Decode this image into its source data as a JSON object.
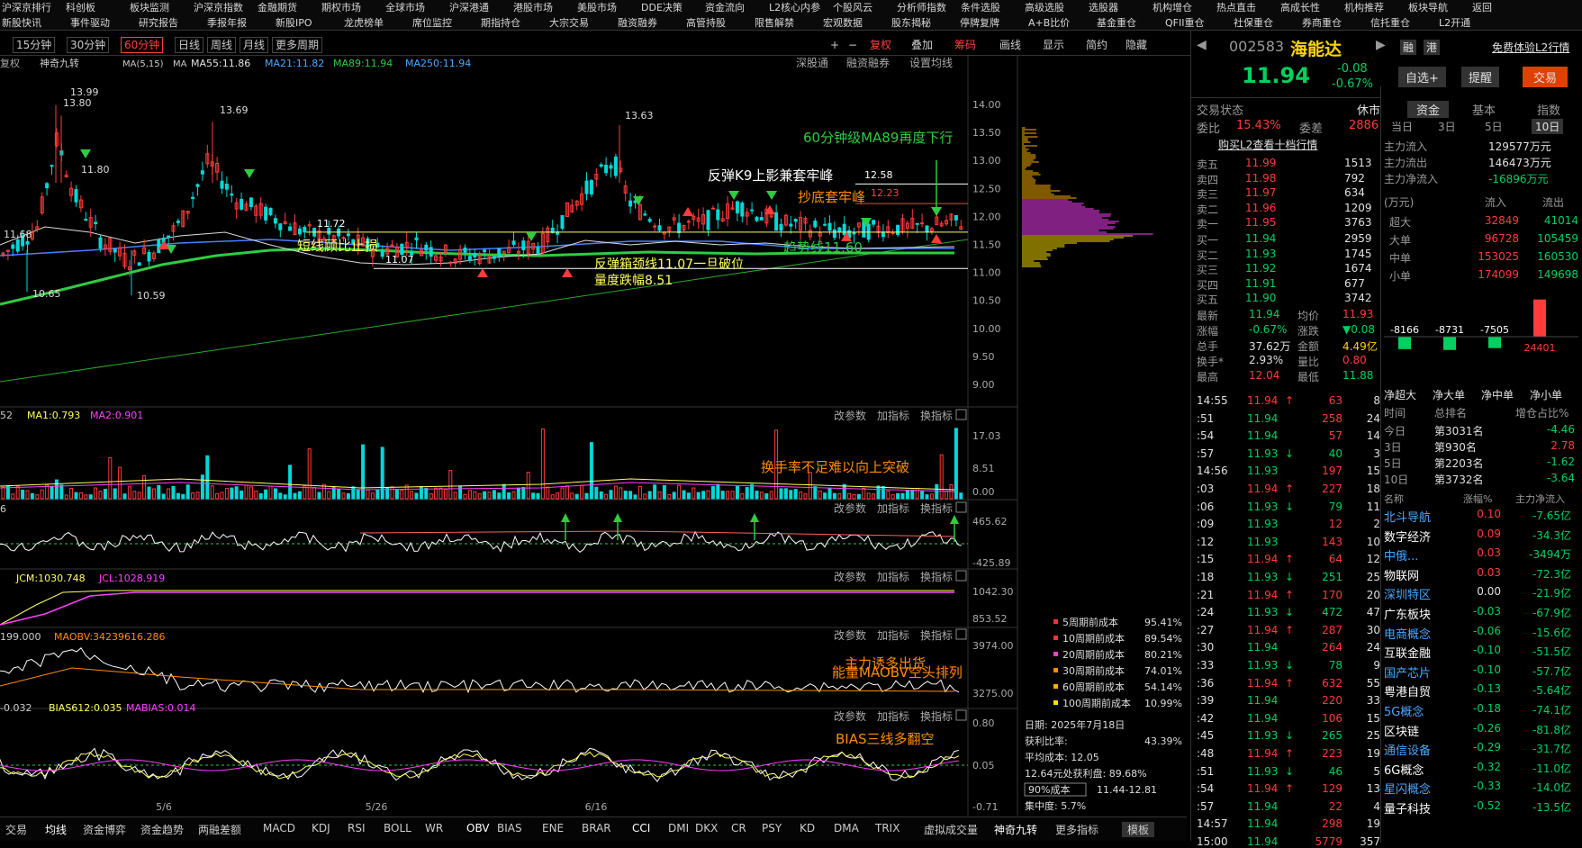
{
  "menu": {
    "row1": [
      "沪深京排行",
      "科创板",
      "板块监测",
      "沪深京指数",
      "金融期货",
      "期权市场",
      "全球市场",
      "沪深港通",
      "港股市场",
      "美股市场",
      "DDE决策",
      "资金流向",
      "L2核心内参",
      "个股风云",
      "分析师指数",
      "条件选股",
      "高级选股",
      "选股器",
      "机构增仓",
      "热点直击",
      "高成长性",
      "机构推荐",
      "板块导航",
      "返回"
    ],
    "row2": [
      "新股快讯",
      "事件驱动",
      "研究报告",
      "季报年报",
      "新股IPO",
      "龙虎榜单",
      "席位监控",
      "期指持仓",
      "大宗交易",
      "融资融券",
      "高管持股",
      "限售解禁",
      "宏观数据",
      "股东揭秘",
      "停牌复牌",
      "A+B比价",
      "基金重仓",
      "QFII重仓",
      "社保重仓",
      "券商重仓",
      "信托重仓",
      "L2开通"
    ]
  },
  "toolbar": {
    "timeframes": [
      "15分钟",
      "30分钟",
      "60分钟",
      "日线",
      "周线",
      "月线",
      "更多周期"
    ],
    "right_tools": [
      "+",
      "−",
      "复权",
      "叠加",
      "筹码",
      "画线",
      "显示",
      "简约",
      "隐藏"
    ],
    "ma_line": {
      "prefix": "复权",
      "indicator": "神奇九转",
      "ma_label": "MA(5,15)",
      "ma": "MA",
      "ma55": "MA55:11.86",
      "ma21": "MA21:11.82",
      "ma89": "MA89:11.94",
      "ma250": "MA250:11.94"
    },
    "chart_links": [
      "深股通",
      "融资融券",
      "设置均线"
    ]
  },
  "annotations": {
    "a1": "60分钟级MA89再度下行",
    "a2": "反弹K9上影兼套牢峰",
    "a3": "抄底套牢峰",
    "a4": "短线顾比止损",
    "a5": "趋势线11.60",
    "a6": "反弹箱颈线11.07一旦破位",
    "a7": "量度跌幅8.51",
    "a8": "换手率不足难以向上突破",
    "a9": "主力诱多出货",
    "a10": "能量MAOBV空头排列",
    "a11": "BIAS三线多翻空",
    "p1": "13.99",
    "p2": "13.80",
    "p3": "13.69",
    "p4": "13.63",
    "p5": "12.58",
    "p6": "12.23",
    "p7": "11.72",
    "p8": "11.07",
    "p9": "10.65",
    "p10": "10.59",
    "p11": "11.68",
    "p12": "11.80"
  },
  "price_axis": [
    "14.00",
    "13.50",
    "13.00",
    "12.50",
    "12.00",
    "11.50",
    "11.00",
    "10.50",
    "10.00",
    "9.50",
    "9.00"
  ],
  "panels": {
    "vol": {
      "label": "52",
      "ma1": "MA1:0.793",
      "ma2": "MA2:0.901",
      "ax": [
        "17.03",
        "8.51",
        "0.00"
      ]
    },
    "p2": {
      "label": "6",
      "ax": [
        "465.62",
        "-425.89"
      ]
    },
    "p3": {
      "jcm": "JCM:1030.748",
      "jcl": "JCL:1028.919",
      "ax": [
        "1042.30",
        "853.52"
      ]
    },
    "p4": {
      "obv": "199.000",
      "maobv": "MAOBV:34239616.286",
      "ax": [
        "3974.00",
        "3275.00"
      ]
    },
    "p5": {
      "bias6": "-0.032",
      "bias612": "BIAS612:0.035",
      "mabias": "MABIAS:0.014",
      "ax": [
        "0.80",
        "0.05",
        "-0.71"
      ]
    },
    "panel_btns": [
      "改参数",
      "加指标",
      "换指标"
    ]
  },
  "dates": [
    "5/6",
    "5/26",
    "6/16"
  ],
  "cost": {
    "legend": [
      {
        "label": "5周期前成本",
        "value": "95.41%",
        "color": "#ff3030"
      },
      {
        "label": "10周期前成本",
        "value": "89.54%",
        "color": "#ff3030"
      },
      {
        "label": "20周期前成本",
        "value": "80.21%",
        "color": "#ff40c0"
      },
      {
        "label": "30周期前成本",
        "value": "74.01%",
        "color": "#ff8c00"
      },
      {
        "label": "60周期前成本",
        "value": "54.14%",
        "color": "#ffb000"
      },
      {
        "label": "100周期前成本",
        "value": "10.99%",
        "color": "#ffe000"
      }
    ],
    "date": "日期: 2025年7月18日",
    "profit_label": "获利比率:",
    "profit": "43.39%",
    "avg": "平均成本: 12.05",
    "at": "12.64元处获利盘: 89.68%",
    "sel": "90%成本",
    "range": "11.44-12.81",
    "conc": "集中度: 5.7%"
  },
  "bottom_tabs": [
    "交易",
    "均线",
    "资金博弈",
    "资金趋势",
    "两融差额",
    "MACD",
    "KDJ",
    "RSI",
    "BOLL",
    "WR",
    "OBV",
    "BIAS",
    "ENE",
    "BRAR",
    "CCI",
    "DMI",
    "DKX",
    "CR",
    "PSY",
    "KD",
    "DMA",
    "TRIX",
    "虚拟成交量",
    "神奇九转",
    "更多指标",
    "模板"
  ],
  "stock": {
    "code": "002583",
    "name": "海能达",
    "trial": "免费体验L2行情",
    "btn1": "融",
    "btn2": "港",
    "price": "11.94",
    "chg": "-0.08",
    "pct": "-0.67%",
    "watch": "自选+",
    "alert": "提醒",
    "trade": "交易"
  },
  "status": {
    "label": "交易状态",
    "value": "休市",
    "wb_label": "委比",
    "wb": "15.43%",
    "wc_label": "委差",
    "wc": "2886",
    "l2": "购买L2查看十档行情"
  },
  "asks": [
    [
      "卖五",
      "11.99",
      "1513"
    ],
    [
      "卖四",
      "11.98",
      "792"
    ],
    [
      "卖三",
      "11.97",
      "634"
    ],
    [
      "卖二",
      "11.96",
      "1209"
    ],
    [
      "卖一",
      "11.95",
      "3763"
    ]
  ],
  "bids": [
    [
      "买一",
      "11.94",
      "2959"
    ],
    [
      "买二",
      "11.93",
      "1745"
    ],
    [
      "买三",
      "11.92",
      "1674"
    ],
    [
      "买四",
      "11.91",
      "677"
    ],
    [
      "买五",
      "11.90",
      "3742"
    ]
  ],
  "stats": [
    [
      "最新",
      "11.94",
      "均价",
      "11.93"
    ],
    [
      "涨幅",
      "-0.67%",
      "涨跌",
      "▼0.08"
    ],
    [
      "总手",
      "37.62万",
      "金额",
      "4.49亿"
    ],
    [
      "换手*",
      "2.93%",
      "量比",
      "0.80"
    ],
    [
      "最高",
      "12.04",
      "最低",
      "11.88"
    ]
  ],
  "ticks": [
    [
      "14:55",
      "11.94",
      "↑",
      "63",
      "8"
    ],
    [
      ":51",
      "11.94",
      "",
      "258",
      "24"
    ],
    [
      ":54",
      "11.94",
      "",
      "57",
      "14"
    ],
    [
      ":57",
      "11.93",
      "↓",
      "40",
      "3"
    ],
    [
      "14:56",
      "11.93",
      "",
      "197",
      "15"
    ],
    [
      ":03",
      "11.94",
      "↑",
      "227",
      "18"
    ],
    [
      ":06",
      "11.93",
      "↓",
      "79",
      "11"
    ],
    [
      ":09",
      "11.93",
      "",
      "12",
      "2"
    ],
    [
      ":12",
      "11.93",
      "",
      "143",
      "10"
    ],
    [
      ":15",
      "11.94",
      "↑",
      "64",
      "12"
    ],
    [
      ":18",
      "11.93",
      "↓",
      "251",
      "25"
    ],
    [
      ":21",
      "11.94",
      "↑",
      "170",
      "20"
    ],
    [
      ":24",
      "11.93",
      "↓",
      "472",
      "47"
    ],
    [
      ":27",
      "11.94",
      "↑",
      "287",
      "30"
    ],
    [
      ":30",
      "11.94",
      "",
      "264",
      "24"
    ],
    [
      ":33",
      "11.93",
      "↓",
      "78",
      "9"
    ],
    [
      ":36",
      "11.94",
      "↑",
      "632",
      "55"
    ],
    [
      ":39",
      "11.94",
      "",
      "220",
      "33"
    ],
    [
      ":42",
      "11.94",
      "",
      "106",
      "15"
    ],
    [
      ":45",
      "11.93",
      "↓",
      "265",
      "25"
    ],
    [
      ":48",
      "11.94",
      "↑",
      "223",
      "19"
    ],
    [
      ":51",
      "11.93",
      "↓",
      "46",
      "5"
    ],
    [
      ":54",
      "11.94",
      "↑",
      "129",
      "13"
    ],
    [
      ":57",
      "11.94",
      "",
      "22",
      "4"
    ],
    [
      "14:57",
      "11.94",
      "",
      "298",
      "19"
    ],
    [
      "15:00",
      "11.94",
      "",
      "5779",
      "357"
    ]
  ],
  "fund": {
    "tabs": [
      "资金",
      "基本",
      "指数"
    ],
    "days": [
      "当日",
      "3日",
      "5日",
      "10日"
    ],
    "main": [
      [
        "主力流入",
        "129577万元"
      ],
      [
        "主力流出",
        "146473万元"
      ],
      [
        "主力净流入",
        "-16896万元"
      ]
    ],
    "unit": "(万元)",
    "in": "流入",
    "out": "流出",
    "rows": [
      [
        "超大",
        "32849",
        "41014"
      ],
      [
        "大单",
        "96728",
        "105459"
      ],
      [
        "中单",
        "153025",
        "160530"
      ],
      [
        "小单",
        "174099",
        "149698"
      ]
    ],
    "bars": [
      {
        "label": "-8166",
        "v": -8166
      },
      {
        "label": "-8731",
        "v": -8731
      },
      {
        "label": "-7505",
        "v": -7505
      },
      {
        "label": "24401",
        "v": 24401
      }
    ],
    "bar_labels": [
      "净超大",
      "净大单",
      "净中单",
      "净小单"
    ],
    "rank_hdr": [
      "时间",
      "总排名",
      "增仓占比%"
    ],
    "ranks": [
      [
        "今日",
        "第3031名",
        "-4.46"
      ],
      [
        "3日",
        "第930名",
        "2.78"
      ],
      [
        "5日",
        "第2203名",
        "-1.62"
      ],
      [
        "10日",
        "第3732名",
        "-3.64"
      ]
    ],
    "sec_hdr": [
      "名称",
      "涨幅%",
      "主力净流入"
    ],
    "sectors": [
      [
        "北斗导航",
        "0.10",
        "-7.65亿"
      ],
      [
        "数字经济",
        "0.09",
        "-34.3亿"
      ],
      [
        "中俄...",
        "0.03",
        "-3494万"
      ],
      [
        "物联网",
        "0.03",
        "-72.3亿"
      ],
      [
        "深圳特区",
        "0.00",
        "-21.9亿"
      ],
      [
        "广东板块",
        "-0.03",
        "-67.9亿"
      ],
      [
        "电商概念",
        "-0.06",
        "-15.6亿"
      ],
      [
        "互联金融",
        "-0.10",
        "-51.5亿"
      ],
      [
        "国产芯片",
        "-0.10",
        "-57.7亿"
      ],
      [
        "粤港自贸",
        "-0.13",
        "-5.64亿"
      ],
      [
        "5G概念",
        "-0.18",
        "-74.1亿"
      ],
      [
        "区块链",
        "-0.26",
        "-81.8亿"
      ],
      [
        "通信设备",
        "-0.29",
        "-31.7亿"
      ],
      [
        "6G概念",
        "-0.32",
        "-11.0亿"
      ],
      [
        "星闪概念",
        "-0.33",
        "-14.0亿"
      ],
      [
        "量子科技",
        "-0.52",
        "-13.5亿"
      ]
    ]
  }
}
